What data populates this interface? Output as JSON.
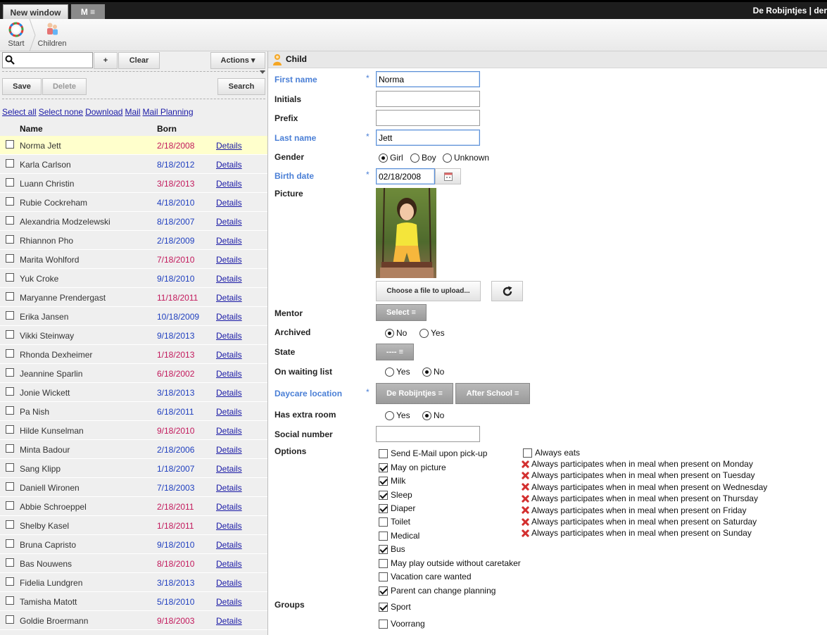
{
  "topbar": {
    "new_window_tab": "New window",
    "menu_tab": "M ≡",
    "brand": "De Robijntjes | der"
  },
  "nav": {
    "start_label": "Start",
    "children_label": "Children"
  },
  "left": {
    "search_placeholder": "",
    "add_label": "+",
    "clear_label": "Clear",
    "actions_label": "Actions ▾",
    "save_label": "Save",
    "delete_label": "Delete",
    "search_label": "Search",
    "links": [
      "Select all",
      "Select none",
      "Download",
      "Mail",
      "Mail Planning"
    ],
    "col_name": "Name",
    "col_born": "Born",
    "details_label": "Details",
    "rows": [
      {
        "name": "Norma Jett",
        "born": "2/18/2008",
        "color": "pink"
      },
      {
        "name": "Karla Carlson",
        "born": "8/18/2012",
        "color": "blue"
      },
      {
        "name": "Luann Christin",
        "born": "3/18/2013",
        "color": "pink"
      },
      {
        "name": "Rubie Cockreham",
        "born": "4/18/2010",
        "color": "blue"
      },
      {
        "name": "Alexandria Modzelewski",
        "born": "8/18/2007",
        "color": "blue"
      },
      {
        "name": "Rhiannon Pho",
        "born": "2/18/2009",
        "color": "blue"
      },
      {
        "name": "Marita Wohlford",
        "born": "7/18/2010",
        "color": "pink"
      },
      {
        "name": "Yuk Croke",
        "born": "9/18/2010",
        "color": "blue"
      },
      {
        "name": "Maryanne Prendergast",
        "born": "11/18/2011",
        "color": "pink"
      },
      {
        "name": "Erika Jansen",
        "born": "10/18/2009",
        "color": "blue"
      },
      {
        "name": "Vikki Steinway",
        "born": "9/18/2013",
        "color": "blue"
      },
      {
        "name": "Rhonda Dexheimer",
        "born": "1/18/2013",
        "color": "pink"
      },
      {
        "name": "Jeannine Sparlin",
        "born": "6/18/2002",
        "color": "pink"
      },
      {
        "name": "Jonie Wickett",
        "born": "3/18/2013",
        "color": "blue"
      },
      {
        "name": "Pa Nish",
        "born": "6/18/2011",
        "color": "blue"
      },
      {
        "name": "Hilde Kunselman",
        "born": "9/18/2010",
        "color": "pink"
      },
      {
        "name": "Minta Badour",
        "born": "2/18/2006",
        "color": "blue"
      },
      {
        "name": "Sang Klipp",
        "born": "1/18/2007",
        "color": "blue"
      },
      {
        "name": "Daniell Wironen",
        "born": "7/18/2003",
        "color": "blue"
      },
      {
        "name": "Abbie Schroeppel",
        "born": "2/18/2011",
        "color": "pink"
      },
      {
        "name": "Shelby Kasel",
        "born": "1/18/2011",
        "color": "pink"
      },
      {
        "name": "Bruna Capristo",
        "born": "9/18/2010",
        "color": "blue"
      },
      {
        "name": "Bas Nouwens",
        "born": "8/18/2010",
        "color": "pink"
      },
      {
        "name": "Fidelia Lundgren",
        "born": "3/18/2013",
        "color": "blue"
      },
      {
        "name": "Tamisha Matott",
        "born": "5/18/2010",
        "color": "blue"
      },
      {
        "name": "Goldie Broermann",
        "born": "9/18/2003",
        "color": "pink"
      }
    ]
  },
  "form": {
    "title": "Child",
    "first_name_label": "First name",
    "first_name": "Norma",
    "initials_label": "Initials",
    "initials": "",
    "prefix_label": "Prefix",
    "prefix": "",
    "last_name_label": "Last name",
    "last_name": "Jett",
    "required_mark": "*",
    "gender_label": "Gender",
    "gender_options": [
      "Girl",
      "Boy",
      "Unknown"
    ],
    "birth_date_label": "Birth date",
    "birth_date": "02/18/2008",
    "picture_label": "Picture",
    "upload_label": "Choose a file to upload...",
    "mentor_label": "Mentor",
    "mentor_select": "Select ≡",
    "archived_label": "Archived",
    "archived_options": [
      "No",
      "Yes"
    ],
    "state_label": "State",
    "state_select": "---- ≡",
    "waiting_label": "On waiting list",
    "waiting_options": [
      "Yes",
      "No"
    ],
    "daycare_label": "Daycare location",
    "daycare_locations": [
      "De Robijntjes ≡",
      "After School ≡"
    ],
    "extra_room_label": "Has extra room",
    "extra_room_options": [
      "Yes",
      "No"
    ],
    "social_label": "Social number",
    "social_number": "",
    "options_label": "Options",
    "options": [
      {
        "label": "Send E-Mail upon pick-up",
        "checked": false
      },
      {
        "label": "May on picture",
        "checked": true
      },
      {
        "label": "Milk",
        "checked": true
      },
      {
        "label": "Sleep",
        "checked": true
      },
      {
        "label": "Diaper",
        "checked": true
      },
      {
        "label": "Toilet",
        "checked": false
      },
      {
        "label": "Medical",
        "checked": false
      },
      {
        "label": "Bus",
        "checked": true
      },
      {
        "label": "May play outside without caretaker",
        "checked": false
      },
      {
        "label": "Vacation care wanted",
        "checked": false
      },
      {
        "label": "Parent can change planning",
        "checked": true
      }
    ],
    "always_eats_label": "Always eats",
    "meal_days": [
      "Always participates when in meal when present on Monday",
      "Always participates when in meal when present on Tuesday",
      "Always participates when in meal when present on Wednesday",
      "Always participates when in meal when present on Thursday",
      "Always participates when in meal when present on Friday",
      "Always participates when in meal when present on Saturday",
      "Always participates when in meal when present on Sunday"
    ],
    "groups_label": "Groups",
    "groups": [
      {
        "label": "Sport",
        "checked": true
      },
      {
        "label": "Voorrang",
        "checked": false
      }
    ]
  },
  "colors": {
    "pink": "#c2185b",
    "blue": "#1f3fbf",
    "required": "#4a7fd6",
    "selected_row": "#ffffcc"
  }
}
